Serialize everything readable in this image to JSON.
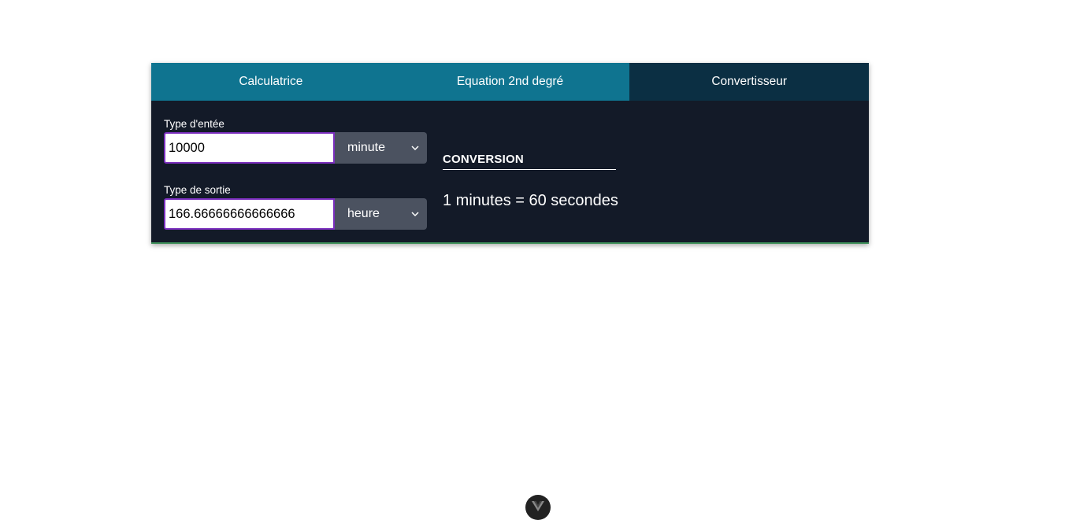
{
  "tabs": [
    {
      "label": "Calculatrice",
      "active": false
    },
    {
      "label": "Equation 2nd degré",
      "active": false
    },
    {
      "label": "Convertisseur",
      "active": true
    }
  ],
  "converter": {
    "input_label": "Type d'entée",
    "input_value": "10000",
    "input_unit": "minute",
    "output_label": "Type de sortie",
    "output_value": "166.66666666666666",
    "output_unit": "heure",
    "conversion_title": "CONVERSION",
    "conversion_result": "1 minutes = 60 secondes"
  },
  "colors": {
    "tab_bg": "#0f7490",
    "tab_active_bg": "#0b2f43",
    "panel_bg": "#131a28",
    "input_border": "#7b2fbe",
    "select_bg": "#4b5260",
    "bottom_accent": "#3e8f5a"
  },
  "icons": {
    "select_arrow": "chevron-down-icon",
    "devtools": "vue-logo-icon"
  }
}
